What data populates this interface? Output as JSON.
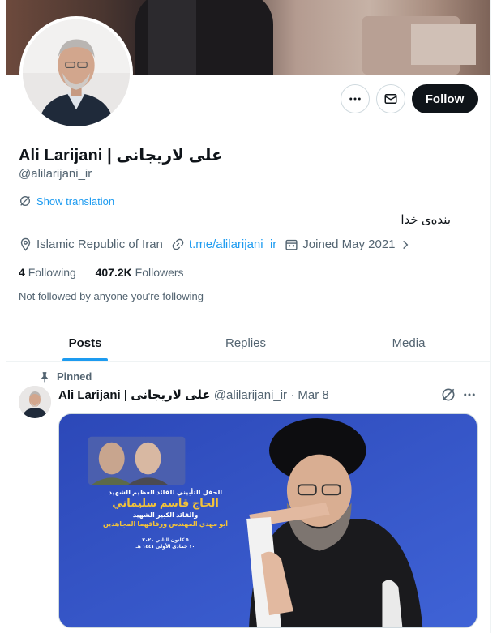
{
  "profile": {
    "display_name": "Ali Larijani | علی لاریجانی",
    "handle": "@alilarijani_ir",
    "show_translation": "Show translation",
    "bio": "بنده‌ی خدا",
    "location": "Islamic Republic of Iran",
    "website": "t.me/alilarijani_ir",
    "joined": "Joined May 2021",
    "following_count": "4",
    "following_label": "Following",
    "followers_count": "407.2K",
    "followers_label": "Followers",
    "not_followed": "Not followed by anyone you're following"
  },
  "actions": {
    "follow_label": "Follow"
  },
  "tabs": [
    {
      "label": "Posts",
      "active": true
    },
    {
      "label": "Replies",
      "active": false
    },
    {
      "label": "Media",
      "active": false
    }
  ],
  "pinned_tweet": {
    "pinned_label": "Pinned",
    "author_name": "Ali Larijani | علی لاریجانی",
    "author_handle": "@alilarijani_ir",
    "separator": "·",
    "date": "Mar 8",
    "media_text": {
      "line1": "الحفل التأبيني للقائد العظيم الشهيد",
      "line2": "الحاج قاسم سليماني",
      "line3": "والقائد الكبير الشهيد",
      "line4": "أبو مهدي المهندس ورفاقهما المجاهدين",
      "line5": "٥ كانون الثاني ٢٠٢٠",
      "line6": "١٠ جمادى الأولى ١٤٤١ هـ"
    }
  },
  "colors": {
    "accent": "#1d9bf0",
    "follow_bg": "#0f1419",
    "secondary_text": "#536471",
    "media_bg": "#3553c4"
  },
  "icons": [
    "more-icon",
    "mail-icon",
    "grok-icon",
    "location-icon",
    "link-icon",
    "calendar-icon",
    "chevron-right-icon",
    "pin-icon",
    "dots-icon"
  ]
}
